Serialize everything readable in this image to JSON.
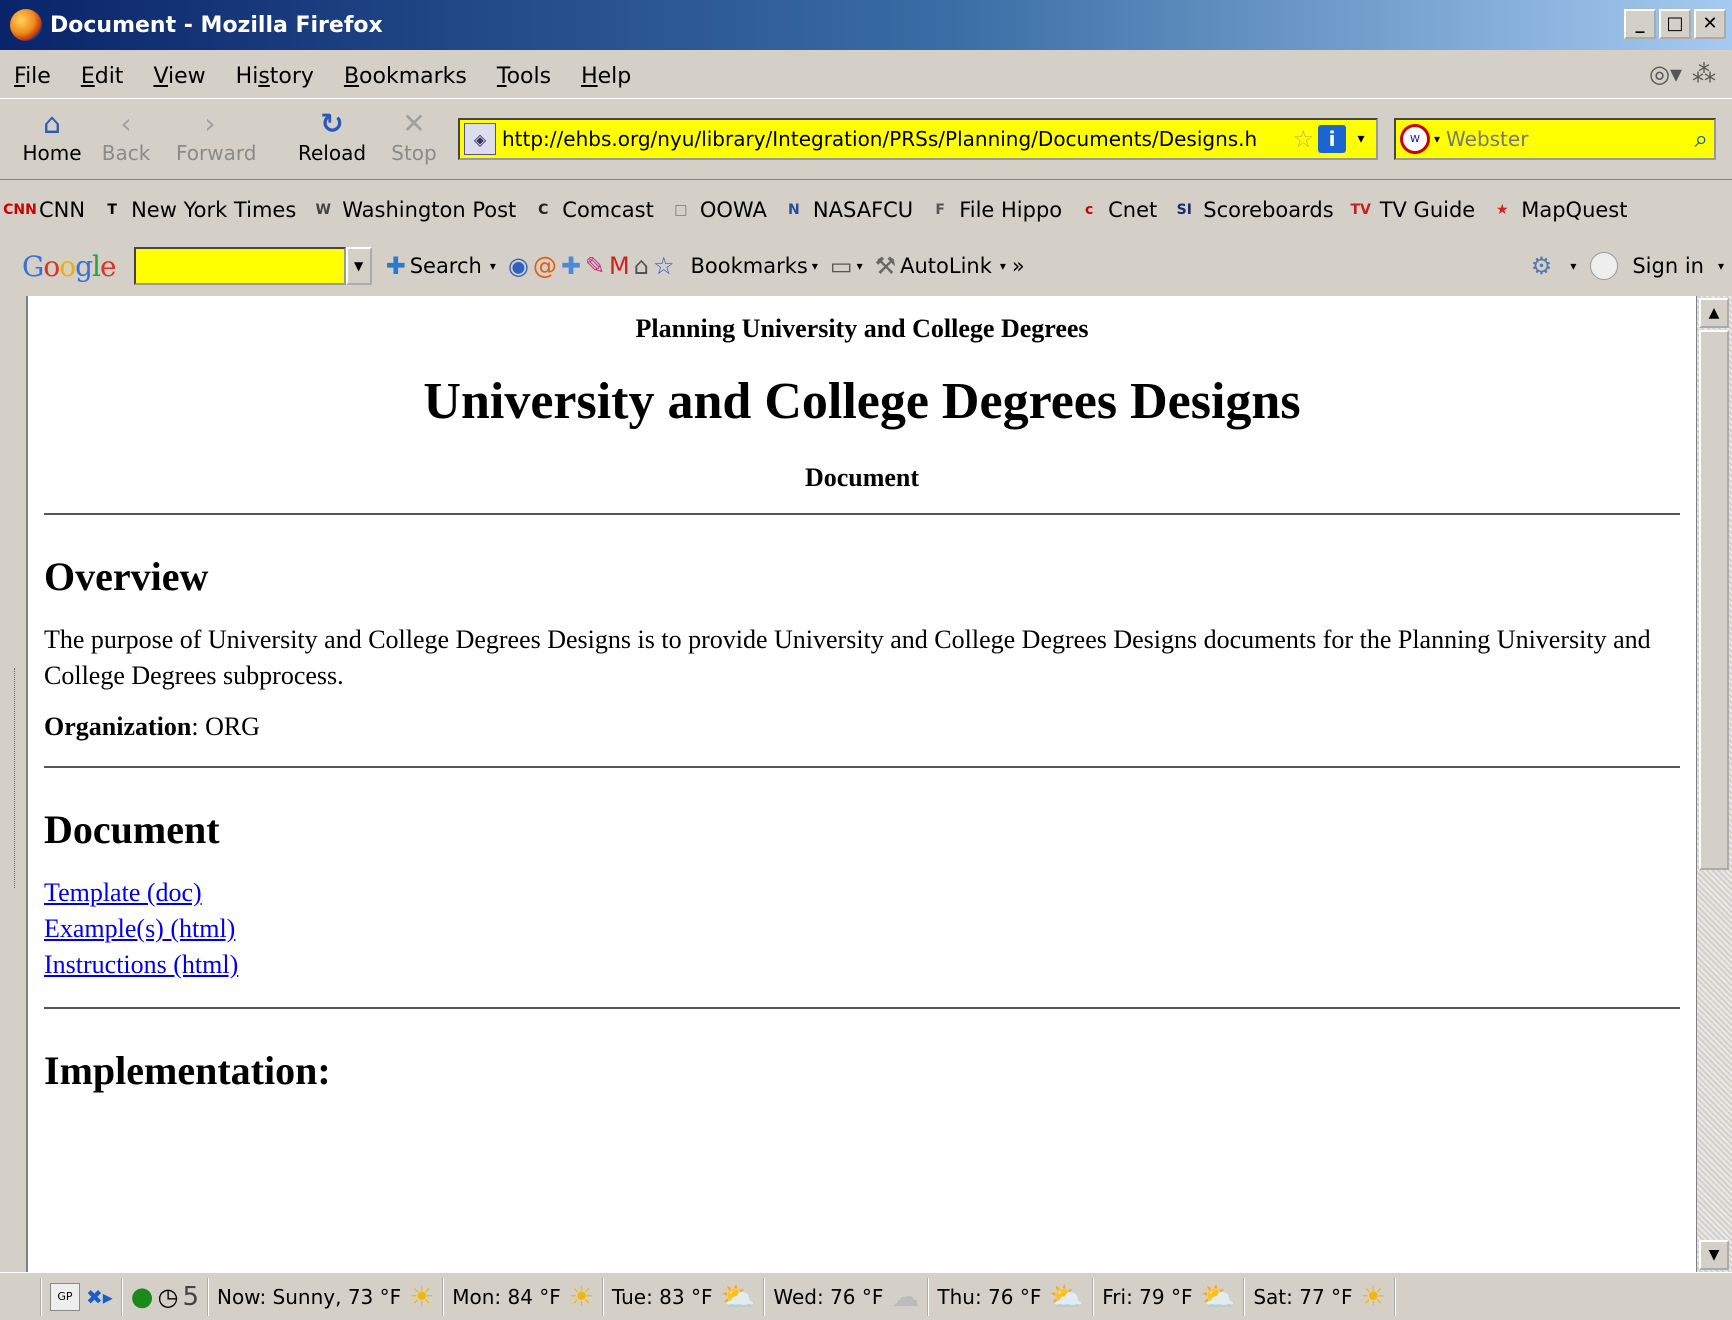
{
  "window": {
    "title": "Document - Mozilla Firefox",
    "minimize": "_",
    "maximize": "□",
    "close": "✕"
  },
  "menu": [
    {
      "pre": "",
      "key": "F",
      "post": "ile"
    },
    {
      "pre": "",
      "key": "E",
      "post": "dit"
    },
    {
      "pre": "",
      "key": "V",
      "post": "iew"
    },
    {
      "pre": "Hi",
      "key": "s",
      "post": "tory"
    },
    {
      "pre": "",
      "key": "B",
      "post": "ookmarks"
    },
    {
      "pre": "",
      "key": "T",
      "post": "ools"
    },
    {
      "pre": "",
      "key": "H",
      "post": "elp"
    }
  ],
  "nav": {
    "home": "Home",
    "back": "Back",
    "forward": "Forward",
    "reload": "Reload",
    "stop": "Stop"
  },
  "url": "http://ehbs.org/nyu/library/Integration/PRSs/Planning/Documents/Designs.h",
  "search_placeholder": "Webster",
  "bookmarks": [
    {
      "label": "CNN",
      "icon": "CNN",
      "color": "#cc0000"
    },
    {
      "label": "New York Times",
      "icon": "T",
      "color": "#000000"
    },
    {
      "label": "Washington Post",
      "icon": "W",
      "color": "#444444"
    },
    {
      "label": "Comcast",
      "icon": "C",
      "color": "#222222"
    },
    {
      "label": "OOWA",
      "icon": "□",
      "color": "#777777"
    },
    {
      "label": "NASAFCU",
      "icon": "N",
      "color": "#2a4c9c"
    },
    {
      "label": "File Hippo",
      "icon": "F",
      "color": "#555555"
    },
    {
      "label": "Cnet",
      "icon": "c",
      "color": "#cc0000"
    },
    {
      "label": "Scoreboards",
      "icon": "SI",
      "color": "#1a2a6c"
    },
    {
      "label": "TV Guide",
      "icon": "TV",
      "color": "#c42020"
    },
    {
      "label": "MapQuest",
      "icon": "★",
      "color": "#d02020"
    }
  ],
  "google_bar": {
    "logo": "Google",
    "search": "Search",
    "bookmarks": "Bookmarks",
    "autolink": "AutoLink",
    "more": "»",
    "sign_in": "Sign in"
  },
  "page": {
    "subhead": "Planning University and College Degrees",
    "title": "University and College Degrees Designs",
    "doc_label": "Document",
    "overview_heading": "Overview",
    "overview_text": "The purpose of University and College Degrees Designs is to provide University and College Degrees Designs documents for the Planning University and College Degrees subprocess.",
    "org_label": "Organization",
    "org_value": ": ORG",
    "document_heading": "Document",
    "links": [
      "Template (doc)",
      "Example(s) (html)",
      "Instructions (html)"
    ],
    "implementation_heading": "Implementation:"
  },
  "status": {
    "gp": "GP",
    "count": "5",
    "weather": [
      {
        "text": "Now: Sunny, 73 °F",
        "icon": "sun"
      },
      {
        "text": "Mon: 84 °F",
        "icon": "sun"
      },
      {
        "text": "Tue: 83 °F",
        "icon": "partly"
      },
      {
        "text": "Wed: 76 °F",
        "icon": "cloud"
      },
      {
        "text": "Thu: 76 °F",
        "icon": "partly"
      },
      {
        "text": "Fri: 79 °F",
        "icon": "partly"
      },
      {
        "text": "Sat: 77 °F",
        "icon": "sun"
      }
    ]
  }
}
